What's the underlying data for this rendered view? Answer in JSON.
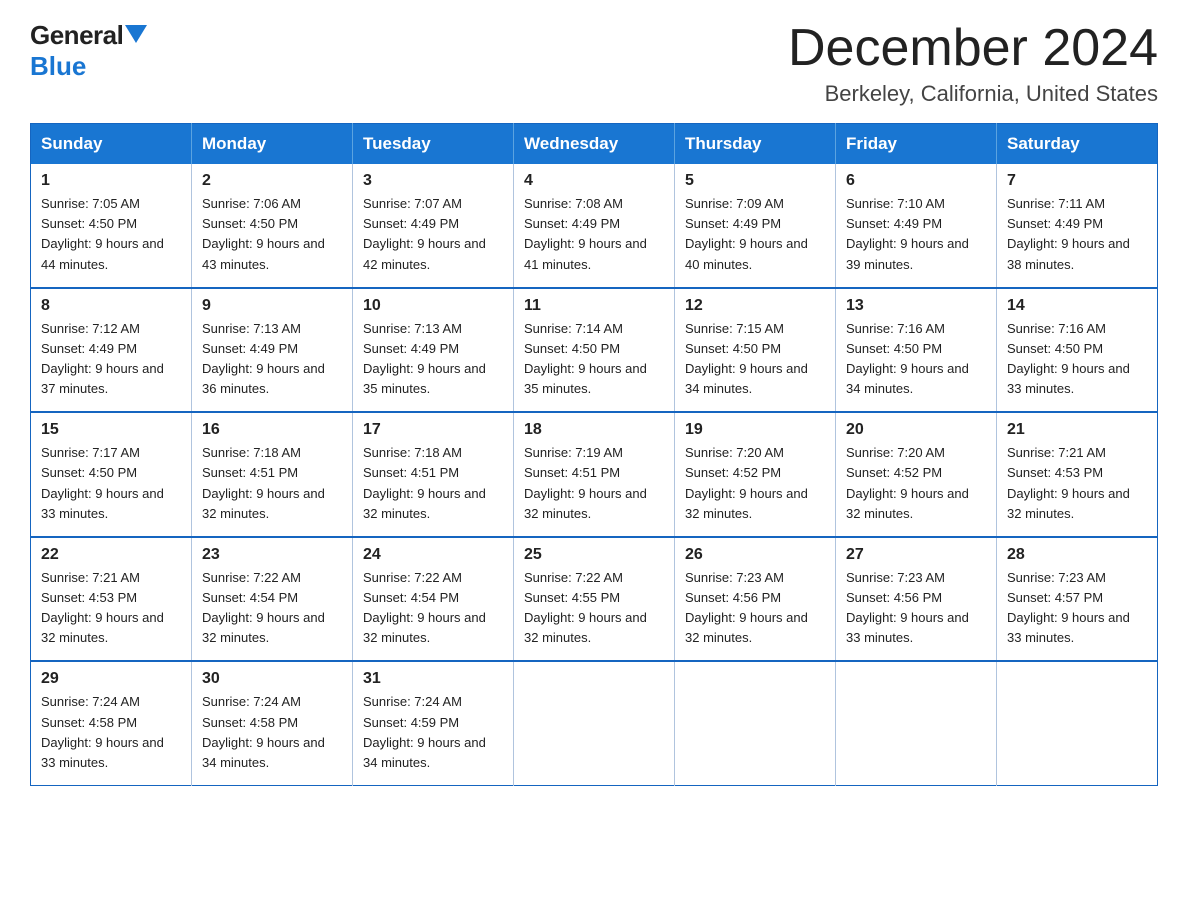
{
  "header": {
    "logo_general": "General",
    "logo_blue": "Blue",
    "month_title": "December 2024",
    "location": "Berkeley, California, United States"
  },
  "calendar": {
    "days_of_week": [
      "Sunday",
      "Monday",
      "Tuesday",
      "Wednesday",
      "Thursday",
      "Friday",
      "Saturday"
    ],
    "weeks": [
      [
        {
          "day": "1",
          "sunrise": "7:05 AM",
          "sunset": "4:50 PM",
          "daylight": "9 hours and 44 minutes."
        },
        {
          "day": "2",
          "sunrise": "7:06 AM",
          "sunset": "4:50 PM",
          "daylight": "9 hours and 43 minutes."
        },
        {
          "day": "3",
          "sunrise": "7:07 AM",
          "sunset": "4:49 PM",
          "daylight": "9 hours and 42 minutes."
        },
        {
          "day": "4",
          "sunrise": "7:08 AM",
          "sunset": "4:49 PM",
          "daylight": "9 hours and 41 minutes."
        },
        {
          "day": "5",
          "sunrise": "7:09 AM",
          "sunset": "4:49 PM",
          "daylight": "9 hours and 40 minutes."
        },
        {
          "day": "6",
          "sunrise": "7:10 AM",
          "sunset": "4:49 PM",
          "daylight": "9 hours and 39 minutes."
        },
        {
          "day": "7",
          "sunrise": "7:11 AM",
          "sunset": "4:49 PM",
          "daylight": "9 hours and 38 minutes."
        }
      ],
      [
        {
          "day": "8",
          "sunrise": "7:12 AM",
          "sunset": "4:49 PM",
          "daylight": "9 hours and 37 minutes."
        },
        {
          "day": "9",
          "sunrise": "7:13 AM",
          "sunset": "4:49 PM",
          "daylight": "9 hours and 36 minutes."
        },
        {
          "day": "10",
          "sunrise": "7:13 AM",
          "sunset": "4:49 PM",
          "daylight": "9 hours and 35 minutes."
        },
        {
          "day": "11",
          "sunrise": "7:14 AM",
          "sunset": "4:50 PM",
          "daylight": "9 hours and 35 minutes."
        },
        {
          "day": "12",
          "sunrise": "7:15 AM",
          "sunset": "4:50 PM",
          "daylight": "9 hours and 34 minutes."
        },
        {
          "day": "13",
          "sunrise": "7:16 AM",
          "sunset": "4:50 PM",
          "daylight": "9 hours and 34 minutes."
        },
        {
          "day": "14",
          "sunrise": "7:16 AM",
          "sunset": "4:50 PM",
          "daylight": "9 hours and 33 minutes."
        }
      ],
      [
        {
          "day": "15",
          "sunrise": "7:17 AM",
          "sunset": "4:50 PM",
          "daylight": "9 hours and 33 minutes."
        },
        {
          "day": "16",
          "sunrise": "7:18 AM",
          "sunset": "4:51 PM",
          "daylight": "9 hours and 32 minutes."
        },
        {
          "day": "17",
          "sunrise": "7:18 AM",
          "sunset": "4:51 PM",
          "daylight": "9 hours and 32 minutes."
        },
        {
          "day": "18",
          "sunrise": "7:19 AM",
          "sunset": "4:51 PM",
          "daylight": "9 hours and 32 minutes."
        },
        {
          "day": "19",
          "sunrise": "7:20 AM",
          "sunset": "4:52 PM",
          "daylight": "9 hours and 32 minutes."
        },
        {
          "day": "20",
          "sunrise": "7:20 AM",
          "sunset": "4:52 PM",
          "daylight": "9 hours and 32 minutes."
        },
        {
          "day": "21",
          "sunrise": "7:21 AM",
          "sunset": "4:53 PM",
          "daylight": "9 hours and 32 minutes."
        }
      ],
      [
        {
          "day": "22",
          "sunrise": "7:21 AM",
          "sunset": "4:53 PM",
          "daylight": "9 hours and 32 minutes."
        },
        {
          "day": "23",
          "sunrise": "7:22 AM",
          "sunset": "4:54 PM",
          "daylight": "9 hours and 32 minutes."
        },
        {
          "day": "24",
          "sunrise": "7:22 AM",
          "sunset": "4:54 PM",
          "daylight": "9 hours and 32 minutes."
        },
        {
          "day": "25",
          "sunrise": "7:22 AM",
          "sunset": "4:55 PM",
          "daylight": "9 hours and 32 minutes."
        },
        {
          "day": "26",
          "sunrise": "7:23 AM",
          "sunset": "4:56 PM",
          "daylight": "9 hours and 32 minutes."
        },
        {
          "day": "27",
          "sunrise": "7:23 AM",
          "sunset": "4:56 PM",
          "daylight": "9 hours and 33 minutes."
        },
        {
          "day": "28",
          "sunrise": "7:23 AM",
          "sunset": "4:57 PM",
          "daylight": "9 hours and 33 minutes."
        }
      ],
      [
        {
          "day": "29",
          "sunrise": "7:24 AM",
          "sunset": "4:58 PM",
          "daylight": "9 hours and 33 minutes."
        },
        {
          "day": "30",
          "sunrise": "7:24 AM",
          "sunset": "4:58 PM",
          "daylight": "9 hours and 34 minutes."
        },
        {
          "day": "31",
          "sunrise": "7:24 AM",
          "sunset": "4:59 PM",
          "daylight": "9 hours and 34 minutes."
        },
        null,
        null,
        null,
        null
      ]
    ]
  }
}
